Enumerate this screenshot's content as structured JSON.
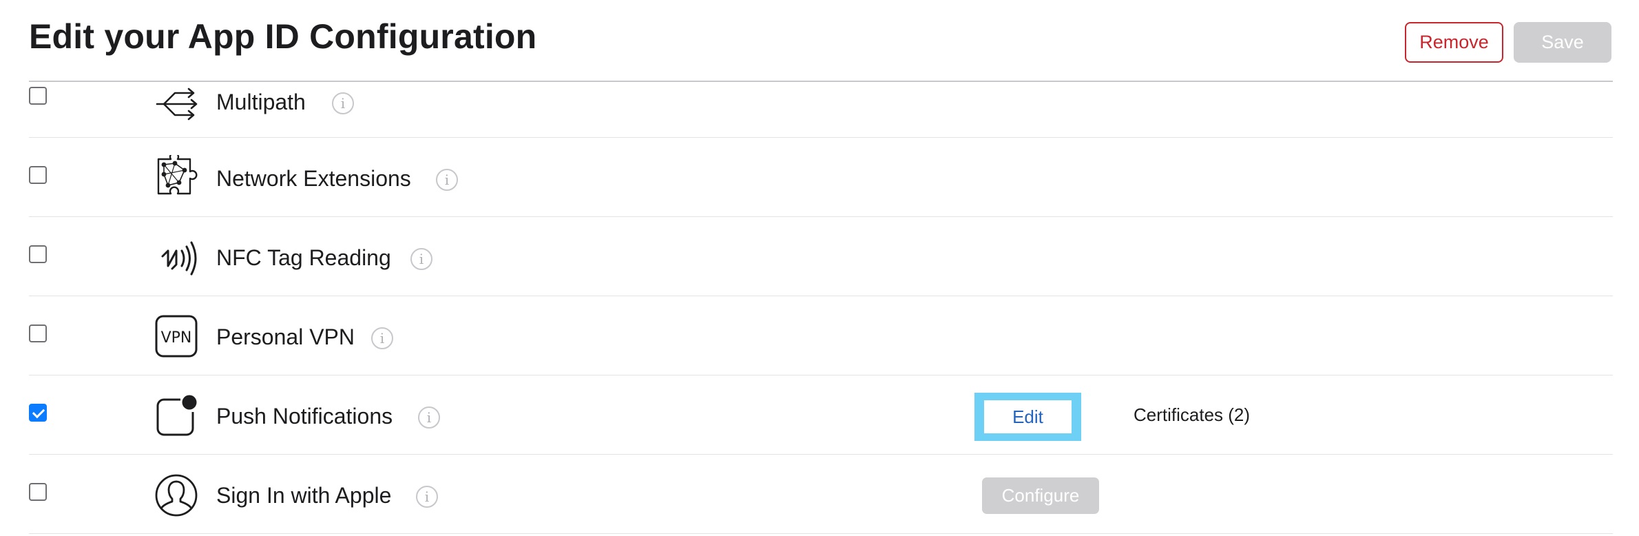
{
  "header": {
    "title": "Edit your App ID Configuration",
    "remove_label": "Remove",
    "save_label": "Save"
  },
  "capabilities": [
    {
      "name": "Multipath",
      "checked": false,
      "icon": "multipath-icon"
    },
    {
      "name": "Network Extensions",
      "checked": false,
      "icon": "network-extensions-icon"
    },
    {
      "name": "NFC Tag Reading",
      "checked": false,
      "icon": "nfc-icon"
    },
    {
      "name": "Personal VPN",
      "checked": false,
      "icon": "vpn-icon",
      "icon_text": "VPN"
    },
    {
      "name": "Push Notifications",
      "checked": true,
      "icon": "push-notifications-icon",
      "action": "Edit",
      "extra": "Certificates (2)"
    },
    {
      "name": "Sign In with Apple",
      "checked": false,
      "icon": "sign-in-with-apple-icon",
      "action": "Configure"
    }
  ],
  "info_glyph": "i",
  "colors": {
    "remove": "#c9252c",
    "disabled": "#cfcfd2",
    "checkbox_checked": "#0b7cff",
    "focus_ring": "#6dd0f4",
    "link": "#2463be"
  }
}
